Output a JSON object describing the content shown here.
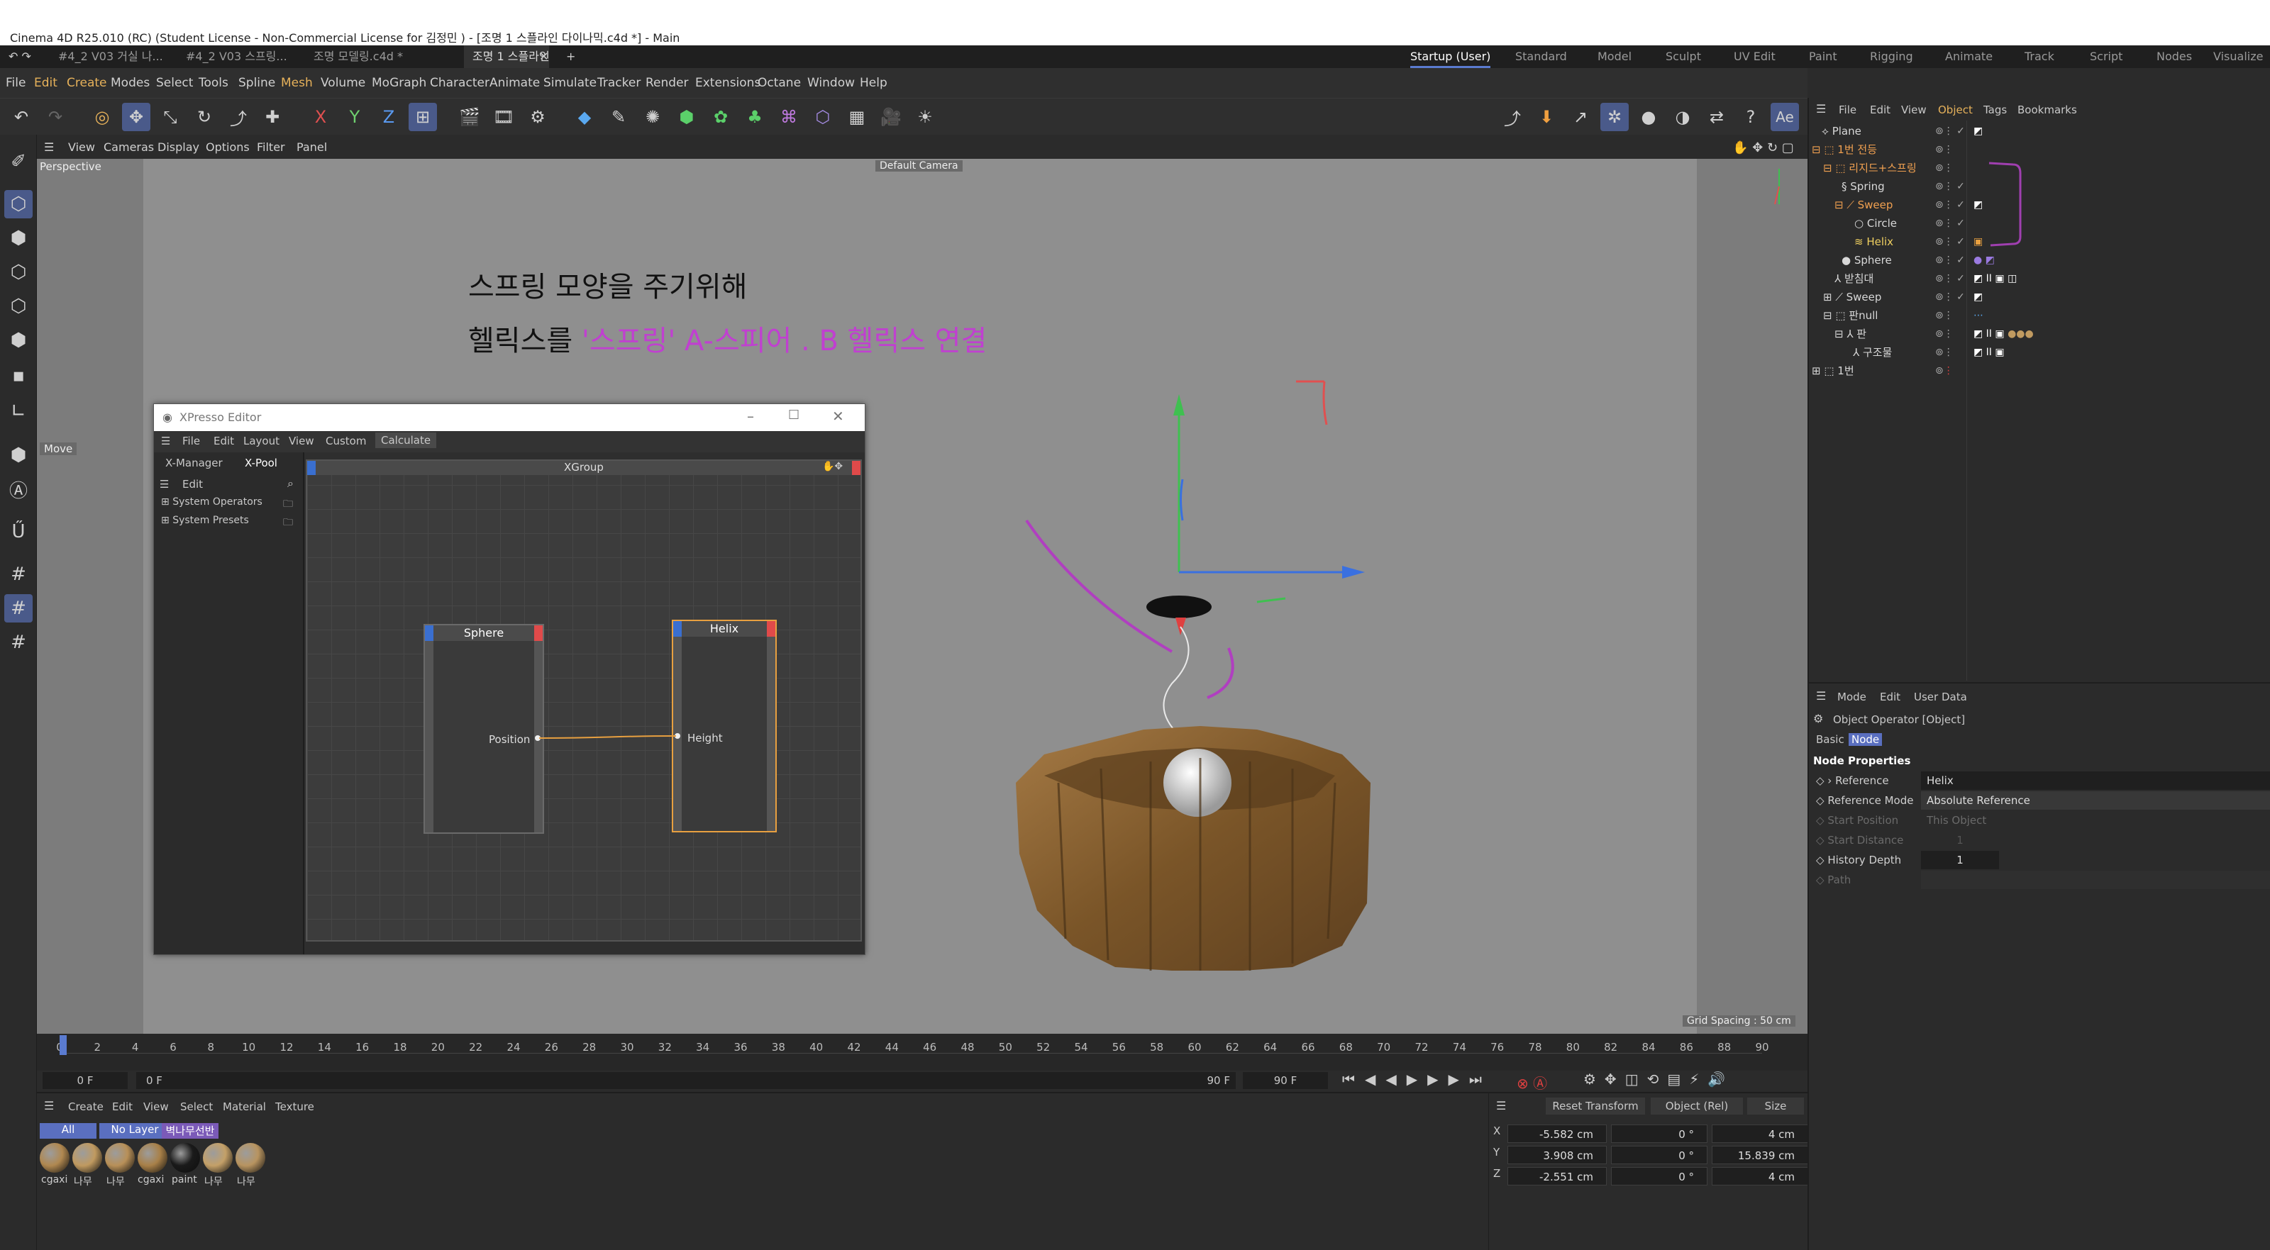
{
  "window": {
    "title": "Cinema 4D R25.010 (RC) (Student License - Non-Commercial License for 김정민 ) - [조명 1 스플라인 다이나믹.c4d *] - Main"
  },
  "doc_tabs": [
    {
      "label": "#4_2 V03 거실 나...",
      "active": false
    },
    {
      "label": "#4_2 V03 스프링...",
      "active": false
    },
    {
      "label": "조명 모델링.c4d *",
      "active": false
    },
    {
      "label": "조명 1 스플라인 ...",
      "active": true
    }
  ],
  "layouts": [
    {
      "label": "Startup (User)",
      "active": true
    },
    {
      "label": "Standard"
    },
    {
      "label": "Model"
    },
    {
      "label": "Sculpt"
    },
    {
      "label": "UV Edit"
    },
    {
      "label": "Paint"
    },
    {
      "label": "Rigging"
    },
    {
      "label": "Animate"
    },
    {
      "label": "Track"
    },
    {
      "label": "Script"
    },
    {
      "label": "Nodes"
    },
    {
      "label": "Visualize"
    }
  ],
  "main_menu": [
    "File",
    "Edit",
    "Create",
    "Modes",
    "Select",
    "Tools",
    "Spline",
    "Mesh",
    "Volume",
    "MoGraph",
    "Character",
    "Animate",
    "Simulate",
    "Tracker",
    "Render",
    "Extensions",
    "Octane",
    "Window",
    "Help"
  ],
  "viewport": {
    "menu": [
      "View",
      "Cameras",
      "Display",
      "Options",
      "Filter",
      "Panel"
    ],
    "label": "Perspective",
    "camera": "Default Camera",
    "move_label": "Move",
    "grid_spacing": "Grid Spacing : 50 cm",
    "annotation_line1": "스프링 모양을 주기위해",
    "annotation_line2_prefix": "헬릭스를 ",
    "annotation_line2_highlight": "'스프링' A-스피어 . B 헬릭스 연결",
    "annotation_color": "#c040d0"
  },
  "xpresso": {
    "title": "XPresso Editor",
    "menu": [
      "File",
      "Edit",
      "Layout",
      "View",
      "Custom",
      "Calculate"
    ],
    "tabs": [
      "X-Manager",
      "X-Pool"
    ],
    "group_title": "XGroup",
    "pool_edit": "Edit",
    "pool_items": [
      "System Operators",
      "System Presets"
    ],
    "nodes": [
      {
        "name": "Sphere",
        "port_label": "Position",
        "port_side": "output"
      },
      {
        "name": "Helix",
        "port_label": "Height",
        "port_side": "input"
      }
    ]
  },
  "timeline": {
    "ticks": [
      "0",
      "2",
      "4",
      "6",
      "8",
      "10",
      "12",
      "14",
      "16",
      "18",
      "20",
      "22",
      "24",
      "26",
      "28",
      "30",
      "32",
      "34",
      "36",
      "38",
      "40",
      "42",
      "44",
      "46",
      "48",
      "50",
      "52",
      "54",
      "56",
      "58",
      "60",
      "62",
      "64",
      "66",
      "68",
      "70",
      "72",
      "74",
      "76",
      "78",
      "80",
      "82",
      "84",
      "86",
      "88",
      "90"
    ],
    "current_frame": "0 F",
    "start_frame": "0 F",
    "end_frame": "90 F",
    "max_frame": "90 F"
  },
  "material_manager": {
    "menu": [
      "Create",
      "Edit",
      "View",
      "Select",
      "Material",
      "Texture"
    ],
    "filters": [
      "All",
      "No Layer",
      "벽나무선반"
    ],
    "materials": [
      {
        "name": "cgaxi",
        "color": "#b08850"
      },
      {
        "name": "나무",
        "color": "#c09a60"
      },
      {
        "name": "나무",
        "color": "#b89058"
      },
      {
        "name": "cgaxi",
        "color": "#a88048"
      },
      {
        "name": "paint",
        "color": "#1a1a1a"
      },
      {
        "name": "나무",
        "color": "#c4a068"
      },
      {
        "name": "나무",
        "color": "#b89460"
      }
    ]
  },
  "coordinates": {
    "buttons": [
      "Reset Transform",
      "Object (Rel)",
      "Size"
    ],
    "rows": [
      {
        "axis": "X",
        "pos": "-5.582 cm",
        "rot": "0 °",
        "size": "4 cm"
      },
      {
        "axis": "Y",
        "pos": "3.908 cm",
        "rot": "0 °",
        "size": "15.839 cm"
      },
      {
        "axis": "Z",
        "pos": "-2.551 cm",
        "rot": "0 °",
        "size": "4 cm"
      }
    ]
  },
  "object_manager": {
    "menu": [
      "File",
      "Edit",
      "View",
      "Object",
      "Tags",
      "Bookmarks"
    ],
    "objects": [
      {
        "name": "Plane",
        "color": "normal"
      },
      {
        "name": "1번 전등",
        "color": "orange"
      },
      {
        "name": "리지드+스프링",
        "color": "orange"
      },
      {
        "name": "Spring",
        "color": "normal"
      },
      {
        "name": "Sweep",
        "color": "orange"
      },
      {
        "name": "Circle",
        "color": "normal"
      },
      {
        "name": "Helix",
        "color": "yellow"
      },
      {
        "name": "Sphere",
        "color": "normal"
      },
      {
        "name": "받침대",
        "color": "normal"
      },
      {
        "name": "Sweep",
        "color": "normal"
      },
      {
        "name": "판null",
        "color": "normal"
      },
      {
        "name": "판",
        "color": "normal"
      },
      {
        "name": "구조물",
        "color": "normal"
      },
      {
        "name": "1번",
        "color": "normal"
      }
    ]
  },
  "attribute_manager": {
    "menu": [
      "Mode",
      "Edit",
      "User Data"
    ],
    "object_title": "Object Operator [Object]",
    "tabs": [
      "Basic",
      "Node"
    ],
    "section": "Node Properties",
    "properties": [
      {
        "label": "Reference",
        "value": "Helix"
      },
      {
        "label": "Reference Mode",
        "value": "Absolute Reference"
      },
      {
        "label": "Start Position",
        "value": "This Object"
      },
      {
        "label": "Start Distance",
        "value": "1"
      },
      {
        "label": "History Depth",
        "value": "1"
      },
      {
        "label": "Path",
        "value": ""
      }
    ]
  }
}
